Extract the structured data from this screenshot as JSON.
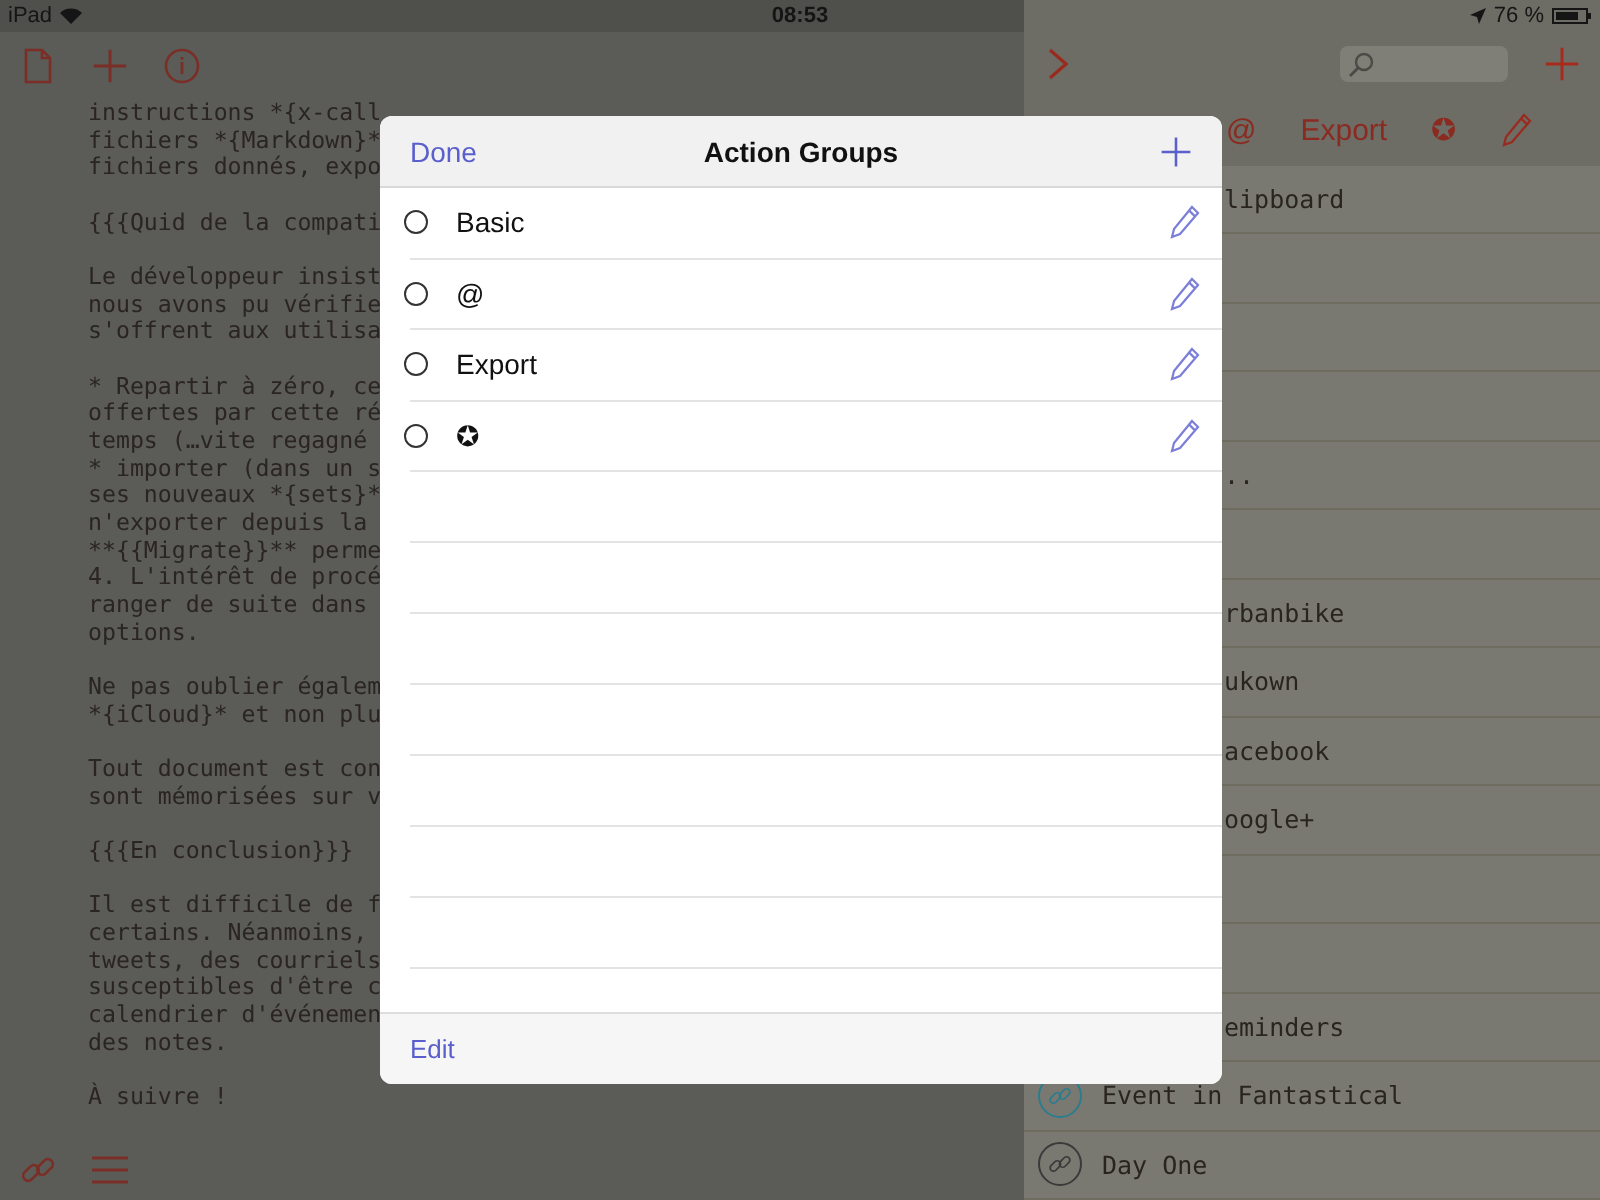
{
  "status_bar": {
    "device": "iPad",
    "time": "08:53",
    "battery": "76 %"
  },
  "editor": {
    "paragraphs": [
      [
        "instructions *{x-call",
        "fichiers *{Markdown}*",
        "fichiers donnés, expo"
      ],
      [
        "{{{Quid de la compati"
      ],
      [
        "Le développeur insist",
        "nous avons pu vérifie",
        "s'offrent aux utilisa"
      ],
      [
        "* Repartir à zéro, ce",
        "offertes par cette ré",
        "temps (…vite regagné",
        "* importer (dans un s",
        "ses nouveaux *{sets}*",
        "n'exporter depuis la",
        "**{{Migrate}}** perme",
        "4. L'intérêt de procé",
        "ranger de suite dans",
        "options."
      ],
      [
        "Ne pas oublier égalem",
        "*{iCloud}* et non plu"
      ],
      [
        "Tout document est con",
        "sont mémorisées sur v"
      ],
      [
        "{{{En conclusion}}}"
      ],
      [
        "Il est difficile de f",
        "certains. Néanmoins,",
        "tweets, des courriels",
        "susceptibles d'être c",
        "calendrier d'événemen",
        "des notes."
      ],
      [
        "À suivre !"
      ]
    ]
  },
  "sidebar": {
    "toolbar": [
      "@",
      "Export",
      "✪"
    ],
    "rows": [
      {
        "kind": "partial",
        "label": "lipboard"
      },
      {
        "kind": "blank"
      },
      {
        "kind": "blank"
      },
      {
        "kind": "blank"
      },
      {
        "kind": "partial",
        "label": ".."
      },
      {
        "kind": "blank"
      },
      {
        "kind": "partial",
        "label": "rbanbike"
      },
      {
        "kind": "partial",
        "label": "ukown"
      },
      {
        "kind": "partial",
        "label": "acebook"
      },
      {
        "kind": "partial",
        "label": "oogle+"
      },
      {
        "kind": "blank"
      },
      {
        "kind": "blank"
      },
      {
        "kind": "partial",
        "label": "eminders"
      },
      {
        "kind": "full",
        "label": "Event in Fantastical",
        "color": "#2b7c8e"
      },
      {
        "kind": "full",
        "label": "Day One",
        "color": "#3a3a3a"
      }
    ]
  },
  "sheet": {
    "done": "Done",
    "title": "Action Groups",
    "edit": "Edit",
    "groups": [
      {
        "label": "Basic",
        "selected": false
      },
      {
        "label": "@",
        "selected": false
      },
      {
        "label": "Export",
        "selected": false
      },
      {
        "label": "✪",
        "selected": false
      }
    ]
  }
}
